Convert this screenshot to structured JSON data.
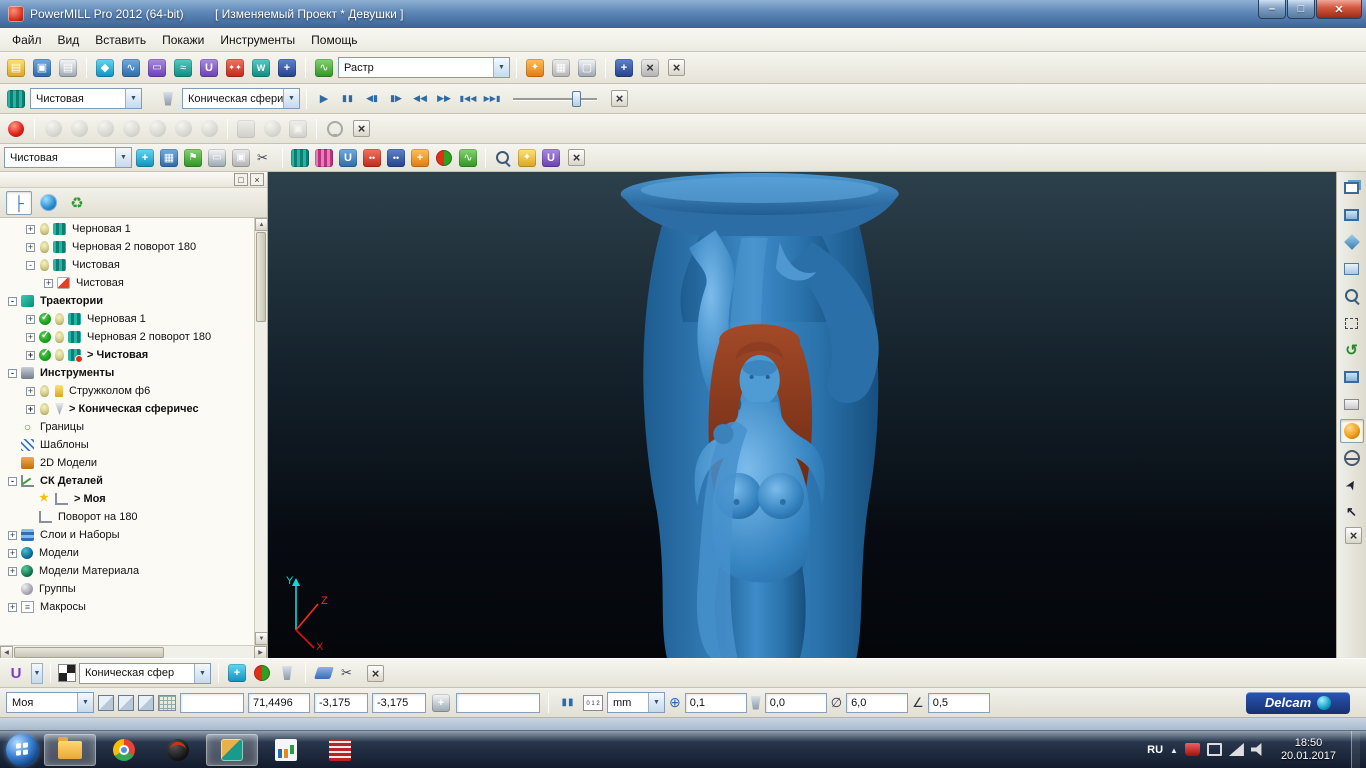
{
  "window": {
    "app_title": "PowerMILL Pro 2012 (64-bit)",
    "doc_title": "[ Изменяемый Проект * Девушки ]"
  },
  "menubar": {
    "items": [
      "Файл",
      "Вид",
      "Вставить",
      "Покажи",
      "Инструменты",
      "Помощь"
    ]
  },
  "toolbars": {
    "main": {
      "strategy_combo": "Растр"
    },
    "simulation": {
      "toolpath_combo": "Чистовая",
      "tool_combo": "Коническая сфери"
    },
    "toolpath": {
      "combo": "Чистовая"
    }
  },
  "explorer": {
    "items": [
      {
        "label": "Черновая 1",
        "level": 2,
        "expander": "+",
        "icons": [
          "bulb",
          "toolpath-item"
        ]
      },
      {
        "label": "Черновая 2  поворот 180",
        "level": 2,
        "expander": "+",
        "icons": [
          "bulb",
          "toolpath-item"
        ]
      },
      {
        "label": "Чистовая",
        "level": 2,
        "expander": "-",
        "icons": [
          "bulb",
          "toolpath-item"
        ]
      },
      {
        "label": "Чистовая",
        "level": 3,
        "expander": "+",
        "icons": [
          "strategy"
        ]
      },
      {
        "label": "Траектории",
        "level": 1,
        "expander": "-",
        "bold": true,
        "icons": [
          "toolpaths"
        ]
      },
      {
        "label": "Черновая 1",
        "level": 2,
        "expander": "+",
        "icons": [
          "check",
          "bulb",
          "toolpath-item"
        ]
      },
      {
        "label": "Черновая 2 поворот 180",
        "level": 2,
        "expander": "+",
        "icons": [
          "check",
          "bulb",
          "toolpath-item"
        ]
      },
      {
        "label": "> Чистовая",
        "level": 2,
        "expander": "+",
        "bold": true,
        "icons": [
          "check",
          "bulb",
          "toolpath-active"
        ]
      },
      {
        "label": "Инструменты",
        "level": 1,
        "expander": "-",
        "bold": true,
        "icons": [
          "tools"
        ]
      },
      {
        "label": "Стружколом ф6",
        "level": 2,
        "expander": "+",
        "icons": [
          "bulb",
          "tool-endmill"
        ]
      },
      {
        "label": "> Коническая сферичес",
        "level": 2,
        "expander": "+",
        "bold": true,
        "icons": [
          "bulb",
          "tool-conical"
        ]
      },
      {
        "label": "Границы",
        "level": 1,
        "expander": "",
        "icons": [
          "boundaries"
        ]
      },
      {
        "label": "Шаблоны",
        "level": 1,
        "expander": "",
        "icons": [
          "patterns"
        ]
      },
      {
        "label": "2D Модели",
        "level": 1,
        "expander": "",
        "icons": [
          "models2d"
        ]
      },
      {
        "label": "СК Деталей",
        "level": 1,
        "expander": "-",
        "bold": true,
        "icons": [
          "workplanes"
        ]
      },
      {
        "label": "> Моя",
        "level": 2,
        "expander": "",
        "bold": true,
        "icons": [
          "workplane-active",
          "workplane"
        ]
      },
      {
        "label": "Поворот на 180",
        "level": 2,
        "expander": "",
        "icons": [
          "workplane"
        ]
      },
      {
        "label": "Слои и Наборы",
        "level": 1,
        "expander": "+",
        "icons": [
          "levels"
        ]
      },
      {
        "label": "Модели",
        "level": 1,
        "expander": "+",
        "icons": [
          "models"
        ]
      },
      {
        "label": "Модели Материала",
        "level": 1,
        "expander": "+",
        "icons": [
          "stock-models"
        ]
      },
      {
        "label": "Группы",
        "level": 1,
        "expander": "",
        "icons": [
          "groups"
        ]
      },
      {
        "label": "Макросы",
        "level": 1,
        "expander": "+",
        "icons": [
          "macros"
        ]
      }
    ]
  },
  "viewport": {
    "axis_x": "X",
    "axis_y": "Y",
    "axis_z": "Z",
    "colors": {
      "model_blue": "#3583c0",
      "hair_brown": "#8e3c22",
      "bg_top": "#2c404b",
      "bg_bottom": "#04060a"
    }
  },
  "bottom_tools": {
    "tool_combo": "Коническая сфер"
  },
  "status": {
    "workplane_combo": "Моя",
    "coord_x": "71,4496",
    "coord_y": "-3,175",
    "coord_z": "-3,175",
    "units_combo": "mm",
    "ruler_scale": "0 1 2",
    "tolerance": "0,1",
    "thickness": "0,0",
    "tool_diameter": "6,0",
    "stepover": "0,5",
    "brand": "Delcam"
  },
  "taskbar": {
    "language": "RU",
    "time": "18:50",
    "date": "20.01.2017"
  }
}
